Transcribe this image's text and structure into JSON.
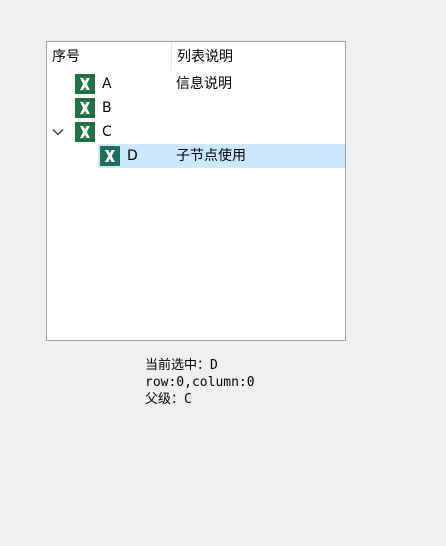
{
  "tree": {
    "columns": [
      "序号",
      "列表说明"
    ],
    "rows": [
      {
        "label": "A",
        "description": "信息说明",
        "icon": "excel-icon",
        "level": 0
      },
      {
        "label": "B",
        "description": "",
        "icon": "excel-icon",
        "level": 0
      },
      {
        "label": "C",
        "description": "",
        "icon": "excel-icon",
        "level": 0,
        "expanded": true
      },
      {
        "label": "D",
        "description": "子节点使用",
        "icon": "excel-icon",
        "level": 1,
        "selected": true
      }
    ],
    "selection_color": "#cce8ff",
    "icon_color": "#217346"
  },
  "info": {
    "current": "当前选中：D",
    "position": "row:0,column:0",
    "parent": "父级：C"
  }
}
